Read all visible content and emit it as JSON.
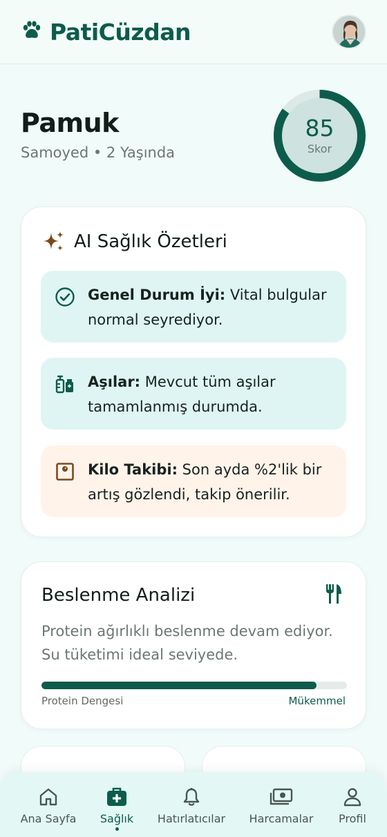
{
  "header": {
    "brand": "PatiCüzdan",
    "icons": {
      "logo": "paw-icon",
      "avatar": "user-avatar"
    }
  },
  "pet": {
    "name": "Pamuk",
    "subtitle": "Samoyed • 2 Yaşında",
    "score": {
      "value": "85",
      "label": "Skor",
      "percent": 85
    }
  },
  "ai_summary": {
    "title": "AI Sağlık Özetleri",
    "items": [
      {
        "bold": "Genel Durum İyi:",
        "text": " Vital bulgular normal seyrediyor.",
        "icon": "check-circle-icon"
      },
      {
        "bold": "Aşılar:",
        "text": " Mevcut tüm aşılar tamamlanmış durumda.",
        "icon": "vaccine-icon"
      },
      {
        "bold": "Kilo Takibi:",
        "text": " Son ayda %2'lik bir artış gözlendi, takip önerilir.",
        "icon": "scale-icon"
      }
    ]
  },
  "nutrition": {
    "title": "Beslenme Analizi",
    "description": "Protein ağırlıklı beslenme devam ediyor. Su tüketimi ideal seviyede.",
    "bar_label": "Protein Dengesi",
    "bar_status": "Mükemmel",
    "bar_percent": 90
  },
  "bottom_nav": [
    {
      "label": "Ana Sayfa",
      "icon": "home-icon",
      "active": false
    },
    {
      "label": "Sağlık",
      "icon": "medical-kit-icon",
      "active": true
    },
    {
      "label": "Hatırlatıcılar",
      "icon": "bell-icon",
      "active": false
    },
    {
      "label": "Harcamalar",
      "icon": "money-icon",
      "active": false
    },
    {
      "label": "Profil",
      "icon": "person-icon",
      "active": false
    }
  ],
  "colors": {
    "primary": "#0d5c4b",
    "background": "#f1fbf9",
    "mint_card": "#dff5f3",
    "peach_card": "#fff3ea",
    "accent_brown": "#7a4a1e"
  }
}
